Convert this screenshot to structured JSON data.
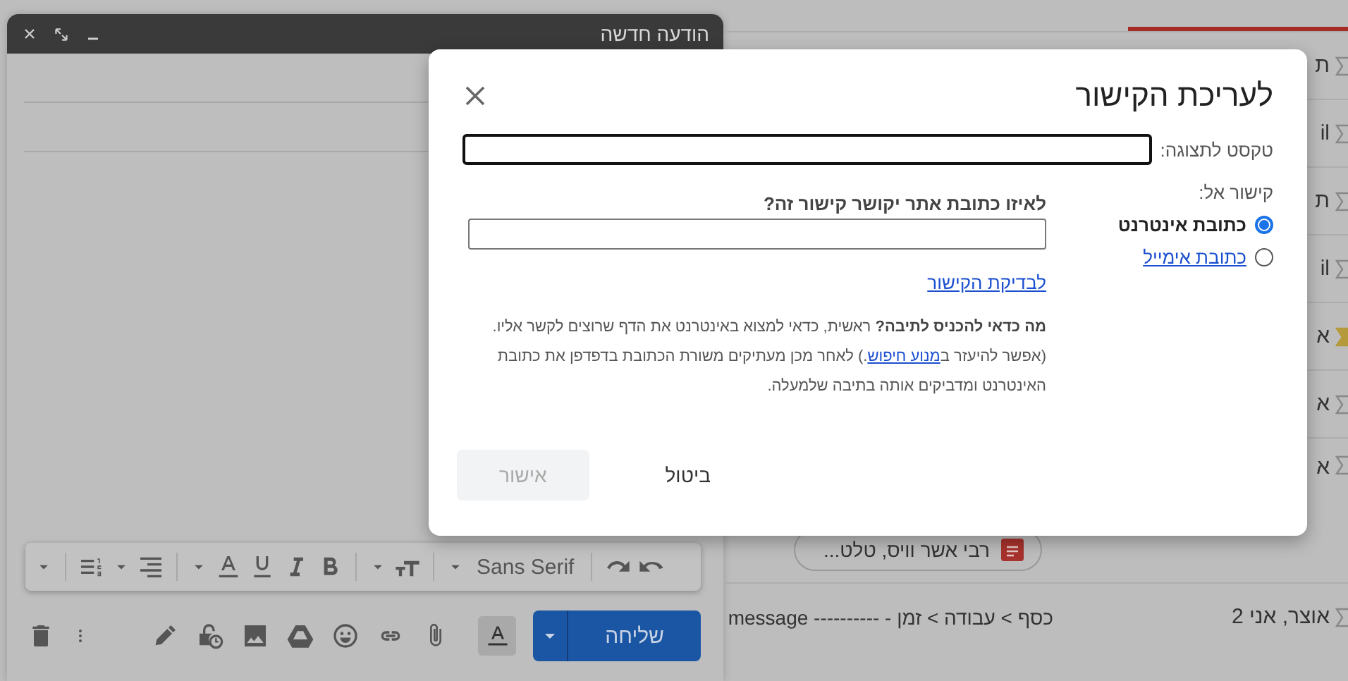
{
  "compose": {
    "title": "הודעה חדשה",
    "font_name": "Sans Serif",
    "formatting_selected": true,
    "send_label": "שליחה"
  },
  "inbox": {
    "rows": [
      {
        "sender": "ת",
        "important": false
      },
      {
        "sender": "il",
        "important": false
      },
      {
        "sender": "ת",
        "important": false
      },
      {
        "sender": "il",
        "important": false
      },
      {
        "sender": "א",
        "important": true
      },
      {
        "sender": "א",
        "important": false
      },
      {
        "sender": "א",
        "important": false,
        "attachment": "רבי אשר וויס, טלט..."
      },
      {
        "sender": "אוצר, אני 2",
        "important": false,
        "subject": "כסף > עבודה > זמן - ---------- message"
      }
    ]
  },
  "dialog": {
    "title": "לעריכת הקישור",
    "display_text_label": "טקסט לתצוגה:",
    "link_to_label": "קישור אל:",
    "link_types": [
      {
        "label": "כתובת אינטרנט",
        "selected": true
      },
      {
        "label": "כתובת אימייל",
        "selected": false
      }
    ],
    "url_question": "לאיזו כתובת אתר יקושר קישור זה?",
    "test_link": "לבדיקת הקישור",
    "help_parts": [
      {
        "kind": "text",
        "text": "**מה כדאי להכניס לתיבה?** ראשית, כדאי למצוא באינטרנט את הדף שרוצים לקשר אליו. (אפשר להיעזר ב"
      },
      {
        "kind": "link",
        "text": "מנוע חיפוש"
      },
      {
        "kind": "text",
        "text": ".) לאחר מכן מעתיקים משורת הכתובת בדפדפן את כתובת האינטרנט ומדביקים אותה בתיבה שלמעלה."
      }
    ],
    "buttons": [
      {
        "label": "ביטול",
        "disabled": false
      },
      {
        "label": "אישור",
        "disabled": true
      }
    ]
  }
}
